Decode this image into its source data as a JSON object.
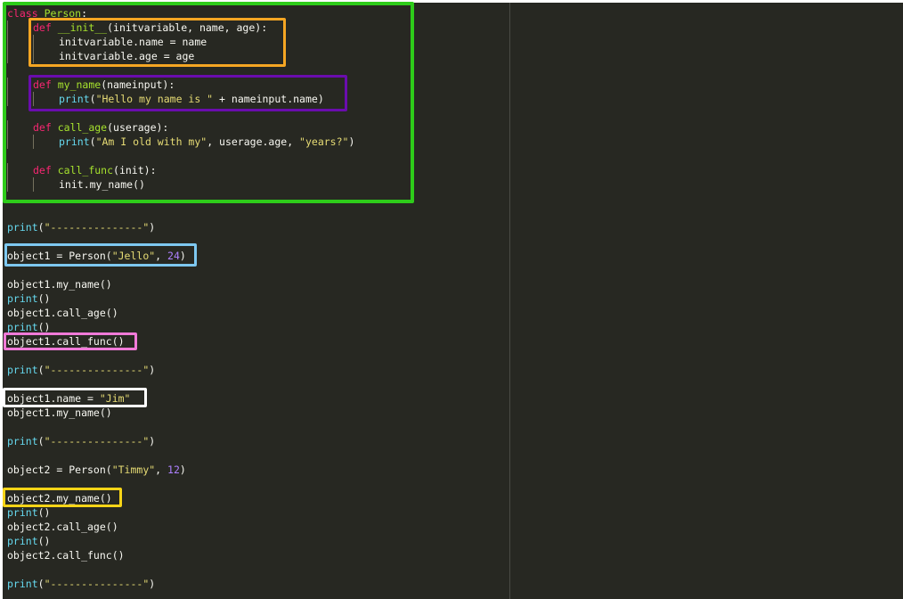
{
  "editor": {
    "theme_colors": {
      "background": "#272822",
      "keyword": "#f92672",
      "function": "#a6e22e",
      "builtin": "#66d9ef",
      "string": "#e6db74",
      "number": "#ae81ff",
      "text": "#f8f8f2"
    },
    "lines": [
      [
        {
          "t": "class",
          "c": "kw-class"
        },
        {
          "t": " ",
          "c": "plain"
        },
        {
          "t": "Person",
          "c": "cls-name"
        },
        {
          "t": ":",
          "c": "plain"
        }
      ],
      [
        {
          "t": "def",
          "c": "kw-def"
        },
        {
          "t": " ",
          "c": "plain"
        },
        {
          "t": "__init__",
          "c": "fn-name"
        },
        {
          "t": "(initvariable, name, age):",
          "c": "plain"
        }
      ],
      [
        {
          "t": "initvariable.name = name",
          "c": "plain"
        }
      ],
      [
        {
          "t": "initvariable.age = age",
          "c": "plain"
        }
      ],
      [],
      [
        {
          "t": "def",
          "c": "kw-def"
        },
        {
          "t": " ",
          "c": "plain"
        },
        {
          "t": "my_name",
          "c": "fn-name"
        },
        {
          "t": "(nameinput):",
          "c": "plain"
        }
      ],
      [
        {
          "t": "print",
          "c": "builtin"
        },
        {
          "t": "(",
          "c": "plain"
        },
        {
          "t": "\"Hello my name is \"",
          "c": "str"
        },
        {
          "t": " + nameinput.name)",
          "c": "plain"
        }
      ],
      [],
      [
        {
          "t": "def",
          "c": "kw-def"
        },
        {
          "t": " ",
          "c": "plain"
        },
        {
          "t": "call_age",
          "c": "fn-name"
        },
        {
          "t": "(userage):",
          "c": "plain"
        }
      ],
      [
        {
          "t": "print",
          "c": "builtin"
        },
        {
          "t": "(",
          "c": "plain"
        },
        {
          "t": "\"Am I old with my\"",
          "c": "str"
        },
        {
          "t": ", userage.age, ",
          "c": "plain"
        },
        {
          "t": "\"years?\"",
          "c": "str"
        },
        {
          "t": ")",
          "c": "plain"
        }
      ],
      [],
      [
        {
          "t": "def",
          "c": "kw-def"
        },
        {
          "t": " ",
          "c": "plain"
        },
        {
          "t": "call_func",
          "c": "fn-name"
        },
        {
          "t": "(init):",
          "c": "plain"
        }
      ],
      [
        {
          "t": "init.my_name()",
          "c": "plain"
        }
      ],
      [],
      [],
      [
        {
          "t": "print",
          "c": "builtin"
        },
        {
          "t": "(",
          "c": "plain"
        },
        {
          "t": "\"---------------\"",
          "c": "str"
        },
        {
          "t": ")",
          "c": "plain"
        }
      ],
      [],
      [
        {
          "t": "object1 = Person(",
          "c": "plain"
        },
        {
          "t": "\"Jello\"",
          "c": "str"
        },
        {
          "t": ", ",
          "c": "plain"
        },
        {
          "t": "24",
          "c": "num"
        },
        {
          "t": ")",
          "c": "plain"
        }
      ],
      [],
      [
        {
          "t": "object1.my_name()",
          "c": "plain"
        }
      ],
      [
        {
          "t": "print",
          "c": "builtin"
        },
        {
          "t": "()",
          "c": "plain"
        }
      ],
      [
        {
          "t": "object1.call_age()",
          "c": "plain"
        }
      ],
      [
        {
          "t": "print",
          "c": "builtin"
        },
        {
          "t": "()",
          "c": "plain"
        }
      ],
      [
        {
          "t": "object1.call_func()",
          "c": "plain"
        }
      ],
      [],
      [
        {
          "t": "print",
          "c": "builtin"
        },
        {
          "t": "(",
          "c": "plain"
        },
        {
          "t": "\"---------------\"",
          "c": "str"
        },
        {
          "t": ")",
          "c": "plain"
        }
      ],
      [],
      [
        {
          "t": "object1.name = ",
          "c": "plain"
        },
        {
          "t": "\"Jim\"",
          "c": "str"
        }
      ],
      [
        {
          "t": "object1.my_name()",
          "c": "plain"
        }
      ],
      [],
      [
        {
          "t": "print",
          "c": "builtin"
        },
        {
          "t": "(",
          "c": "plain"
        },
        {
          "t": "\"---------------\"",
          "c": "str"
        },
        {
          "t": ")",
          "c": "plain"
        }
      ],
      [],
      [
        {
          "t": "object2 = Person(",
          "c": "plain"
        },
        {
          "t": "\"Timmy\"",
          "c": "str"
        },
        {
          "t": ", ",
          "c": "plain"
        },
        {
          "t": "12",
          "c": "num"
        },
        {
          "t": ")",
          "c": "plain"
        }
      ],
      [],
      [
        {
          "t": "object2.my_name()",
          "c": "plain"
        }
      ],
      [
        {
          "t": "print",
          "c": "builtin"
        },
        {
          "t": "()",
          "c": "plain"
        }
      ],
      [
        {
          "t": "object2.call_age()",
          "c": "plain"
        }
      ],
      [
        {
          "t": "print",
          "c": "builtin"
        },
        {
          "t": "()",
          "c": "plain"
        }
      ],
      [
        {
          "t": "object2.call_func()",
          "c": "plain"
        }
      ],
      [],
      [
        {
          "t": "print",
          "c": "builtin"
        },
        {
          "t": "(",
          "c": "plain"
        },
        {
          "t": "\"---------------\"",
          "c": "str"
        },
        {
          "t": ")",
          "c": "plain"
        }
      ]
    ]
  },
  "highlights": [
    {
      "name": "class-person-highlight",
      "color": "#2ecc1a"
    },
    {
      "name": "init-method-highlight",
      "color": "#f5a623"
    },
    {
      "name": "my-name-method-highlight",
      "color": "#6a0dad"
    },
    {
      "name": "object1-creation-highlight",
      "color": "#7ec8f0"
    },
    {
      "name": "object1-call-func-highlight",
      "color": "#f07ad8"
    },
    {
      "name": "object1-rename-highlight",
      "color": "#ffffff"
    },
    {
      "name": "object2-my-name-highlight",
      "color": "#f7d417"
    }
  ]
}
